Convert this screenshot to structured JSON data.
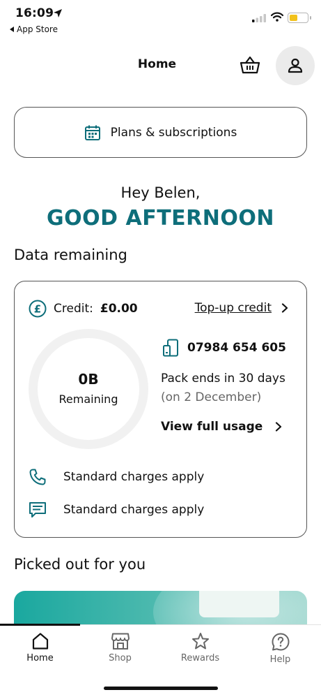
{
  "status_bar": {
    "time": "16:09",
    "back_app": "App Store",
    "battery_color": "#f2c21c"
  },
  "header": {
    "title": "Home",
    "basket_icon": "basket-icon",
    "profile_icon": "person-icon"
  },
  "plans": {
    "label": "Plans & subscriptions",
    "icon": "calendar-icon"
  },
  "greeting": {
    "hello": "Hey Belen,",
    "time_of_day": "GOOD AFTERNOON",
    "accent_color": "#0e6e7a"
  },
  "data_section": {
    "title": "Data remaining",
    "credit_label": "Credit:",
    "credit_value": "£0.00",
    "topup_label": "Top-up credit",
    "remaining_value": "0B",
    "remaining_label": "Remaining",
    "phone_number": "07984 654 605",
    "pack_ends": "Pack ends in 30 days",
    "pack_date": "(on 2 December)",
    "view_usage": "View full usage",
    "call_charges": "Standard charges apply",
    "text_charges": "Standard charges apply"
  },
  "picked": {
    "title": "Picked out for you"
  },
  "tabs": [
    {
      "label": "Home",
      "icon": "home-icon",
      "active": true
    },
    {
      "label": "Shop",
      "icon": "shop-icon",
      "active": false
    },
    {
      "label": "Rewards",
      "icon": "star-icon",
      "active": false
    },
    {
      "label": "Help",
      "icon": "help-icon",
      "active": false
    }
  ]
}
